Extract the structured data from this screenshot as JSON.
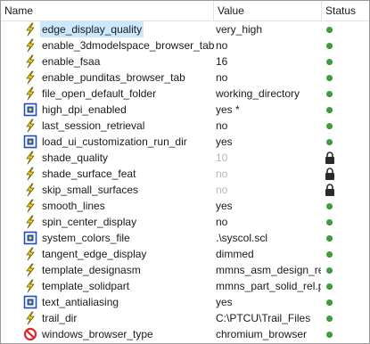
{
  "columns": {
    "name": "Name",
    "value": "Value",
    "status": "Status"
  },
  "rows": [
    {
      "name": "edge_display_quality",
      "value": "very_high",
      "icon": "lightning-icon",
      "status": "ok",
      "selected": true
    },
    {
      "name": "enable_3dmodelspace_browser_tab",
      "value": "no",
      "icon": "lightning-icon",
      "status": "ok"
    },
    {
      "name": "enable_fsaa",
      "value": "16",
      "icon": "lightning-icon",
      "status": "ok"
    },
    {
      "name": "enable_punditas_browser_tab",
      "value": "no",
      "icon": "lightning-icon",
      "status": "ok"
    },
    {
      "name": "file_open_default_folder",
      "value": "working_directory",
      "icon": "lightning-icon",
      "status": "ok"
    },
    {
      "name": "high_dpi_enabled",
      "value": "yes *",
      "icon": "startup-icon",
      "status": "ok"
    },
    {
      "name": "last_session_retrieval",
      "value": "no",
      "icon": "lightning-icon",
      "status": "ok"
    },
    {
      "name": "load_ui_customization_run_dir",
      "value": "yes",
      "icon": "startup-icon",
      "status": "ok"
    },
    {
      "name": "shade_quality",
      "value": "10",
      "icon": "lightning-icon",
      "status": "locked",
      "disabled": true
    },
    {
      "name": "shade_surface_feat",
      "value": "no",
      "icon": "lightning-icon",
      "status": "locked",
      "disabled": true
    },
    {
      "name": "skip_small_surfaces",
      "value": "no",
      "icon": "lightning-icon",
      "status": "locked",
      "disabled": true
    },
    {
      "name": "smooth_lines",
      "value": "yes",
      "icon": "lightning-icon",
      "status": "ok"
    },
    {
      "name": "spin_center_display",
      "value": "no",
      "icon": "lightning-icon",
      "status": "ok"
    },
    {
      "name": "system_colors_file",
      "value": ".\\syscol.scl",
      "icon": "startup-icon",
      "status": "ok"
    },
    {
      "name": "tangent_edge_display",
      "value": "dimmed",
      "icon": "lightning-icon",
      "status": "ok"
    },
    {
      "name": "template_designasm",
      "value": "mmns_asm_design_rel",
      "icon": "lightning-icon",
      "status": "ok"
    },
    {
      "name": "template_solidpart",
      "value": "mmns_part_solid_rel.p",
      "icon": "lightning-icon",
      "status": "ok"
    },
    {
      "name": "text_antialiasing",
      "value": "yes",
      "icon": "startup-icon",
      "status": "ok"
    },
    {
      "name": "trail_dir",
      "value": "C:\\PTCU\\Trail_Files",
      "icon": "lightning-icon",
      "status": "ok"
    },
    {
      "name": "windows_browser_type",
      "value": "chromium_browser",
      "icon": "prohibited-icon",
      "status": "ok"
    }
  ],
  "colors": {
    "selection": "#cce8ff",
    "status_ok": "#3f9f3f",
    "lightning": "#e8d21e",
    "startup_frame": "#1f4fb3",
    "prohibited": "#d9282f",
    "disabled_text": "#b5b5b5"
  }
}
